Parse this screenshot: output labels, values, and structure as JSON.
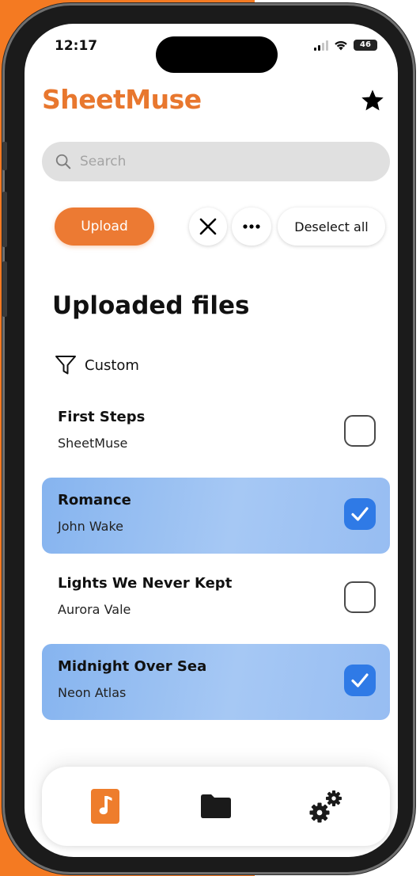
{
  "status_bar": {
    "time": "12:17",
    "battery": "46"
  },
  "header": {
    "title": "SheetMuse"
  },
  "search": {
    "placeholder": "Search"
  },
  "toolbar": {
    "upload_label": "Upload",
    "deselect_label": "Deselect all"
  },
  "section": {
    "title": "Uploaded files"
  },
  "filter": {
    "label": "Custom"
  },
  "files": [
    {
      "title": "First Steps",
      "artist": "SheetMuse",
      "selected": false
    },
    {
      "title": "Romance",
      "artist": "John Wake",
      "selected": true
    },
    {
      "title": "Lights We Never Kept",
      "artist": "Aurora Vale",
      "selected": false
    },
    {
      "title": "Midnight Over Sea",
      "artist": "Neon Atlas",
      "selected": true
    }
  ],
  "tabs": [
    {
      "name": "music-note-icon",
      "active": true
    },
    {
      "name": "folder-icon",
      "active": false
    },
    {
      "name": "gears-icon",
      "active": false
    }
  ],
  "colors": {
    "accent": "#e8772e",
    "selected_row": "#8fb9f0",
    "checkbox_on": "#2f7ae6",
    "background_left": "#f47a22"
  }
}
